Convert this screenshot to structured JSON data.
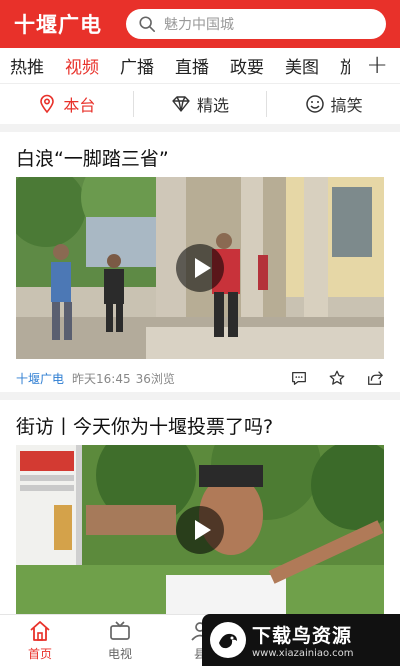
{
  "header": {
    "title": "十堰广电",
    "search_placeholder": "魅力中国城"
  },
  "tabs": [
    "热推",
    "视频",
    "广播",
    "直播",
    "政要",
    "美图",
    "旅"
  ],
  "active_tab": "视频",
  "subfilters": [
    {
      "label": "本台",
      "icon": "location-pin-icon"
    },
    {
      "label": "精选",
      "icon": "diamond-icon"
    },
    {
      "label": "搞笑",
      "icon": "smiley-icon"
    }
  ],
  "articles": [
    {
      "title": "白浪“一脚踏三省”",
      "source": "十堰广电",
      "time": "昨天16:45",
      "views": "36浏览"
    },
    {
      "title": "街访丨今天你为十堰投票了吗?"
    }
  ],
  "bottom_nav": [
    {
      "label": "首页",
      "icon": "home-icon"
    },
    {
      "label": "电视",
      "icon": "tv-icon"
    },
    {
      "label": "县",
      "icon": "person-icon"
    }
  ],
  "watermark": {
    "text": "下载鸟资源",
    "url": "www.xiazainiao.com"
  },
  "colors": {
    "brand": "#e8312a",
    "source_link": "#2d7dd2"
  }
}
